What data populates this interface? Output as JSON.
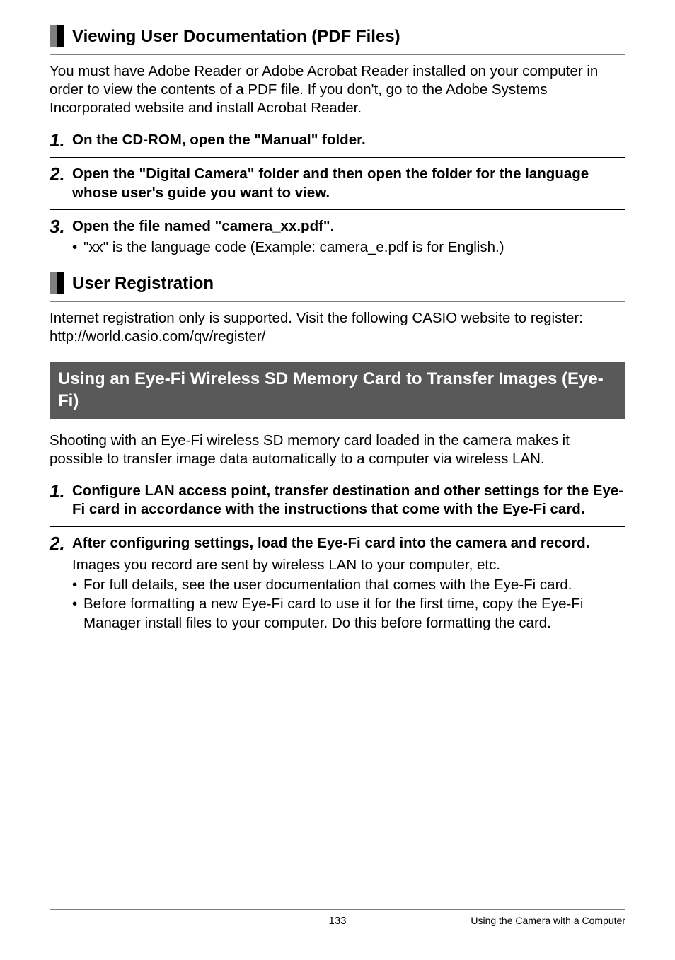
{
  "section1": {
    "heading": "Viewing User Documentation (PDF Files)",
    "intro": "You must have Adobe Reader or Adobe Acrobat Reader installed on your computer in order to view the contents of a PDF file. If you don't, go to the Adobe Systems Incorporated website and install Acrobat Reader.",
    "steps": [
      {
        "num": "1.",
        "bold": "On the CD-ROM, open the \"Manual\" folder."
      },
      {
        "num": "2.",
        "bold": "Open the \"Digital Camera\" folder and then open the folder for the language whose user's guide you want to view."
      },
      {
        "num": "3.",
        "bold": "Open the file named \"camera_xx.pdf\"."
      }
    ],
    "step3_bullet": "\"xx\" is the language code (Example: camera_e.pdf is for English.)"
  },
  "section2": {
    "heading": "User Registration",
    "body1": "Internet registration only is supported. Visit the following CASIO website to register:",
    "body2": "http://world.casio.com/qv/register/"
  },
  "section3": {
    "banner": "Using an Eye-Fi Wireless SD Memory Card to Transfer Images (Eye-Fi)",
    "intro": "Shooting with an Eye-Fi wireless SD memory card loaded in the camera makes it possible to transfer image data automatically to a computer via wireless LAN.",
    "steps": [
      {
        "num": "1.",
        "bold": "Configure LAN access point, transfer destination and other settings for the Eye-Fi card in accordance with the instructions that come with the Eye-Fi card."
      },
      {
        "num": "2.",
        "bold": "After configuring settings, load the Eye-Fi card into the camera and record."
      }
    ],
    "step2_body": "Images you record are sent by wireless LAN to your computer, etc.",
    "step2_bullets": [
      "For full details, see the user documentation that comes with the Eye-Fi card.",
      "Before formatting a new Eye-Fi card to use it for the first time, copy the Eye-Fi Manager install files to your computer. Do this before formatting the card."
    ]
  },
  "footer": {
    "page": "133",
    "chapter": "Using the Camera with a Computer"
  }
}
